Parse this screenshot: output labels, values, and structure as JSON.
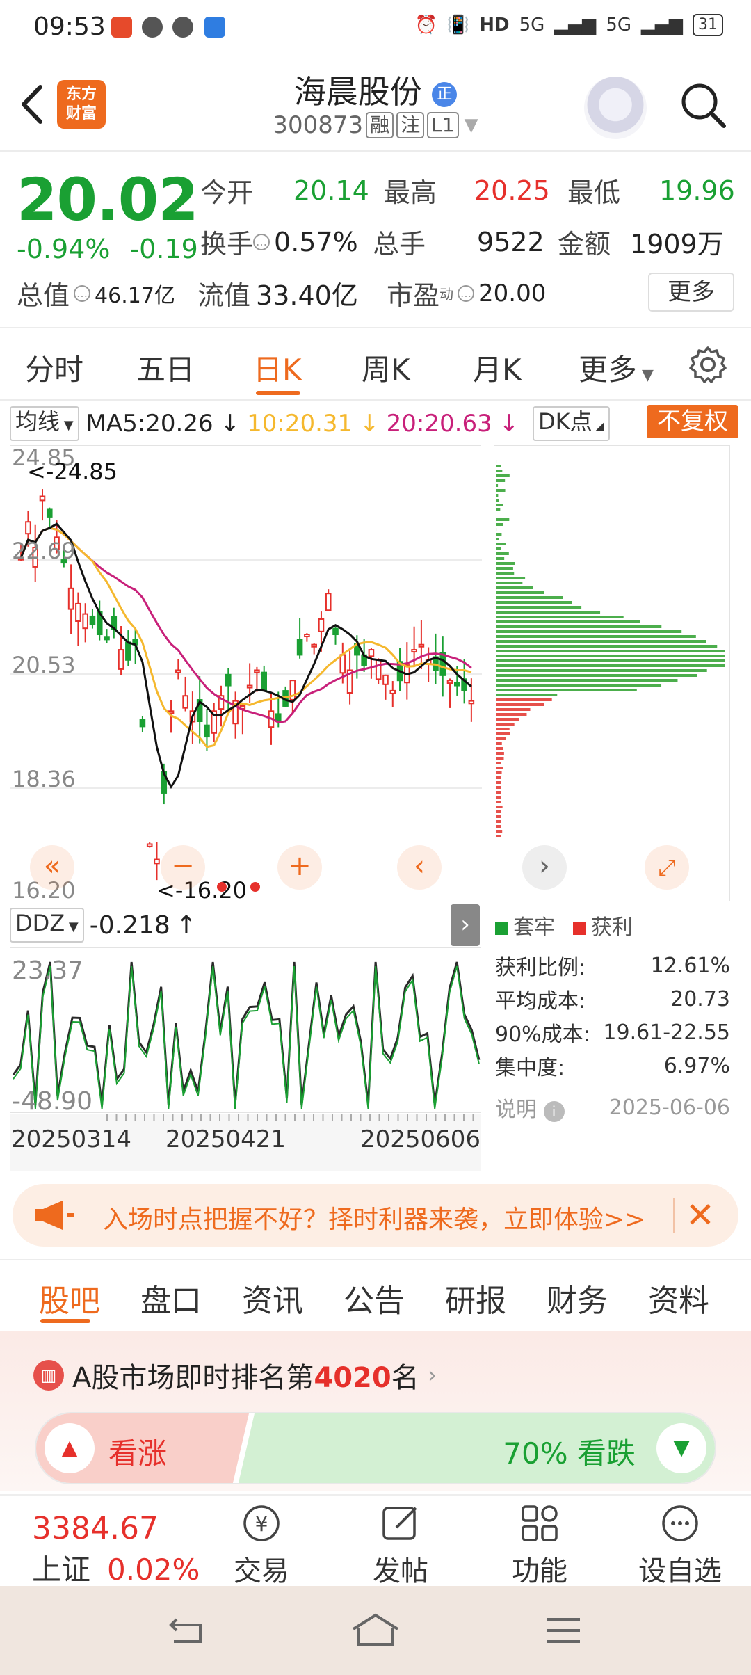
{
  "status_bar": {
    "time": "09:53",
    "network": "5G",
    "battery": "31"
  },
  "header": {
    "logo_line1": "东方",
    "logo_line2": "财富",
    "stock_name": "海晨股份",
    "stock_badge": "正",
    "stock_code": "300873",
    "tag_rong": "融",
    "tag_zhu": "注",
    "tag_level": "L1"
  },
  "quote": {
    "price": "20.02",
    "change_pct": "-0.94%",
    "change_abs": "-0.19",
    "open_label": "今开",
    "open": "20.14",
    "high_label": "最高",
    "high": "20.25",
    "low_label": "最低",
    "low": "19.96",
    "turnover_label": "换手",
    "turnover": "0.57%",
    "volume_label": "总手",
    "volume": "9522",
    "amount_label": "金额",
    "amount": "1909万",
    "mktcap_label": "总值",
    "mktcap": "46.17亿",
    "float_label": "流值",
    "float_cap": "33.40亿",
    "pe_label": "市盈",
    "pe_sup": "动",
    "pe": "20.00",
    "more_label": "更多"
  },
  "period_tabs": [
    "分时",
    "五日",
    "日K",
    "周K",
    "月K",
    "更多"
  ],
  "chart_header": {
    "indicator": "均线",
    "ma5": "MA5:20.26",
    "ma10": "10:20.31",
    "ma20": "20:20.63",
    "dk_label": "DK点",
    "adjust_label": "不复权"
  },
  "kchart": {
    "y_ticks": [
      "24.85",
      "22.69",
      "20.53",
      "18.36",
      "16.20"
    ],
    "high_marker": "<-24.85",
    "low_marker": "<-16.20"
  },
  "ddz": {
    "label": "DDZ",
    "value": "-0.218",
    "y_max": "23.37",
    "y_min": "-48.90",
    "dates": [
      "20250314",
      "20250421",
      "20250606"
    ]
  },
  "chips": {
    "legend_loss": "套牢",
    "legend_profit": "获利",
    "rows": [
      {
        "label": "获利比例:",
        "value": "12.61%"
      },
      {
        "label": "平均成本:",
        "value": "20.73"
      },
      {
        "label": "90%成本:",
        "value": "19.61-22.55"
      },
      {
        "label": "集中度:",
        "value": "6.97%"
      }
    ],
    "note_label": "说明",
    "date": "2025-06-06"
  },
  "banner": {
    "text": "入场时点把握不好？择时利器来袭，立即体验>>"
  },
  "content_tabs": [
    "股吧",
    "盘口",
    "资讯",
    "公告",
    "研报",
    "财务",
    "资料"
  ],
  "rank": {
    "prefix": "A股市场即时排名第",
    "number": "4020",
    "suffix": "名"
  },
  "vote": {
    "up_label": "看涨",
    "down_label": "70% 看跌",
    "down_pct": 70
  },
  "bottom_bar": {
    "index_value": "3384.67",
    "index_name": "上证",
    "index_change": "0.02%",
    "trade": "交易",
    "post": "发帖",
    "functions": "功能",
    "watchlist": "设自选"
  },
  "colors": {
    "accent": "#ee6a1e",
    "up": "#e6302b",
    "down": "#1aa033",
    "ma10": "#f5b82e",
    "ma20": "#c8207a"
  }
}
